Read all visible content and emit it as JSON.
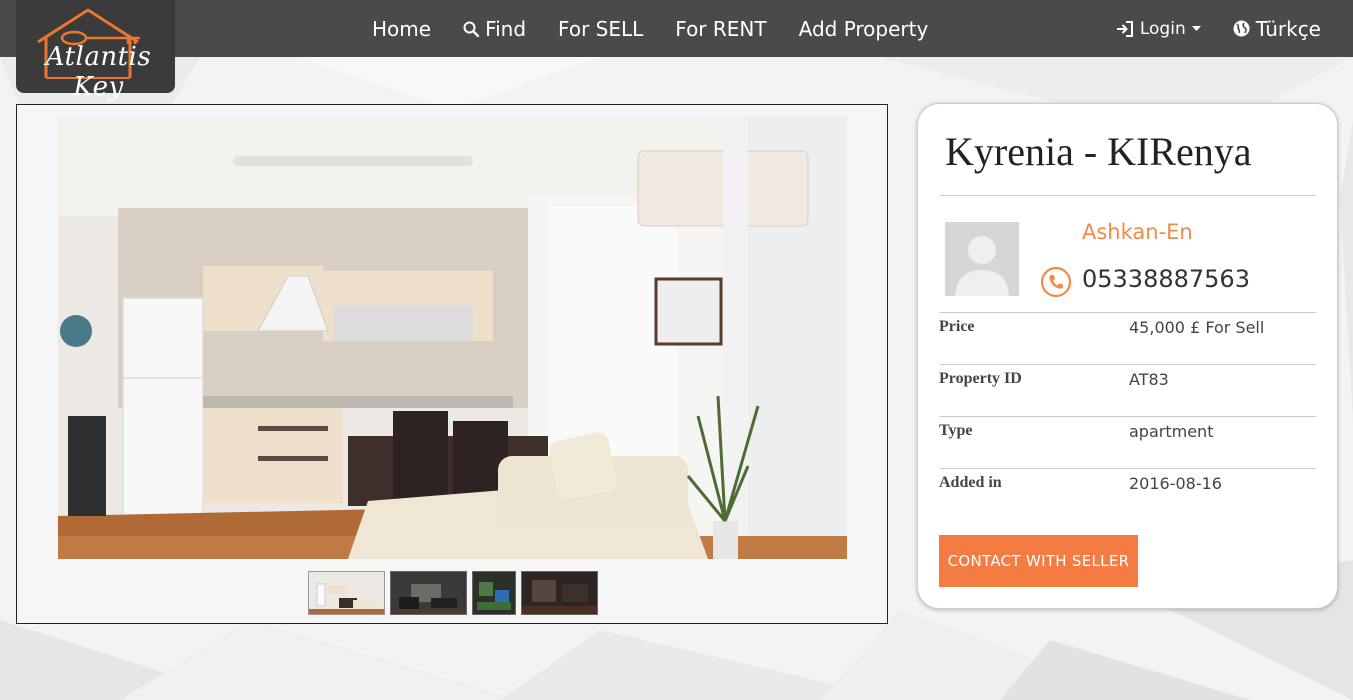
{
  "brand": {
    "logo_text": "Atlantis Key"
  },
  "nav": {
    "home": "Home",
    "find": "Find",
    "for_sell": "For SELL",
    "for_rent": "For RENT",
    "add_property": "Add Property",
    "login": "Login",
    "language": "Türkçe"
  },
  "property": {
    "title": "Kyrenia - KIRenya",
    "seller_name": "Ashkan-En",
    "phone": "05338887563",
    "details": [
      {
        "label": "Price",
        "value": "45,000 £ For Sell"
      },
      {
        "label": "Property ID",
        "value": "AT83"
      },
      {
        "label": "Type",
        "value": "apartment"
      },
      {
        "label": "Added in",
        "value": "2016-08-16"
      }
    ],
    "contact_button": "CONTACT WITH SELLER"
  },
  "gallery": {
    "thumbnail_count": 4
  },
  "colors": {
    "navbar": "#4a4a4a",
    "accent": "#f47c42",
    "seller": "#f08a4b"
  },
  "icons": [
    "search-icon",
    "login-icon",
    "caret-down-icon",
    "globe-icon",
    "phone-icon",
    "user-placeholder-icon",
    "house-key-logo-icon"
  ]
}
